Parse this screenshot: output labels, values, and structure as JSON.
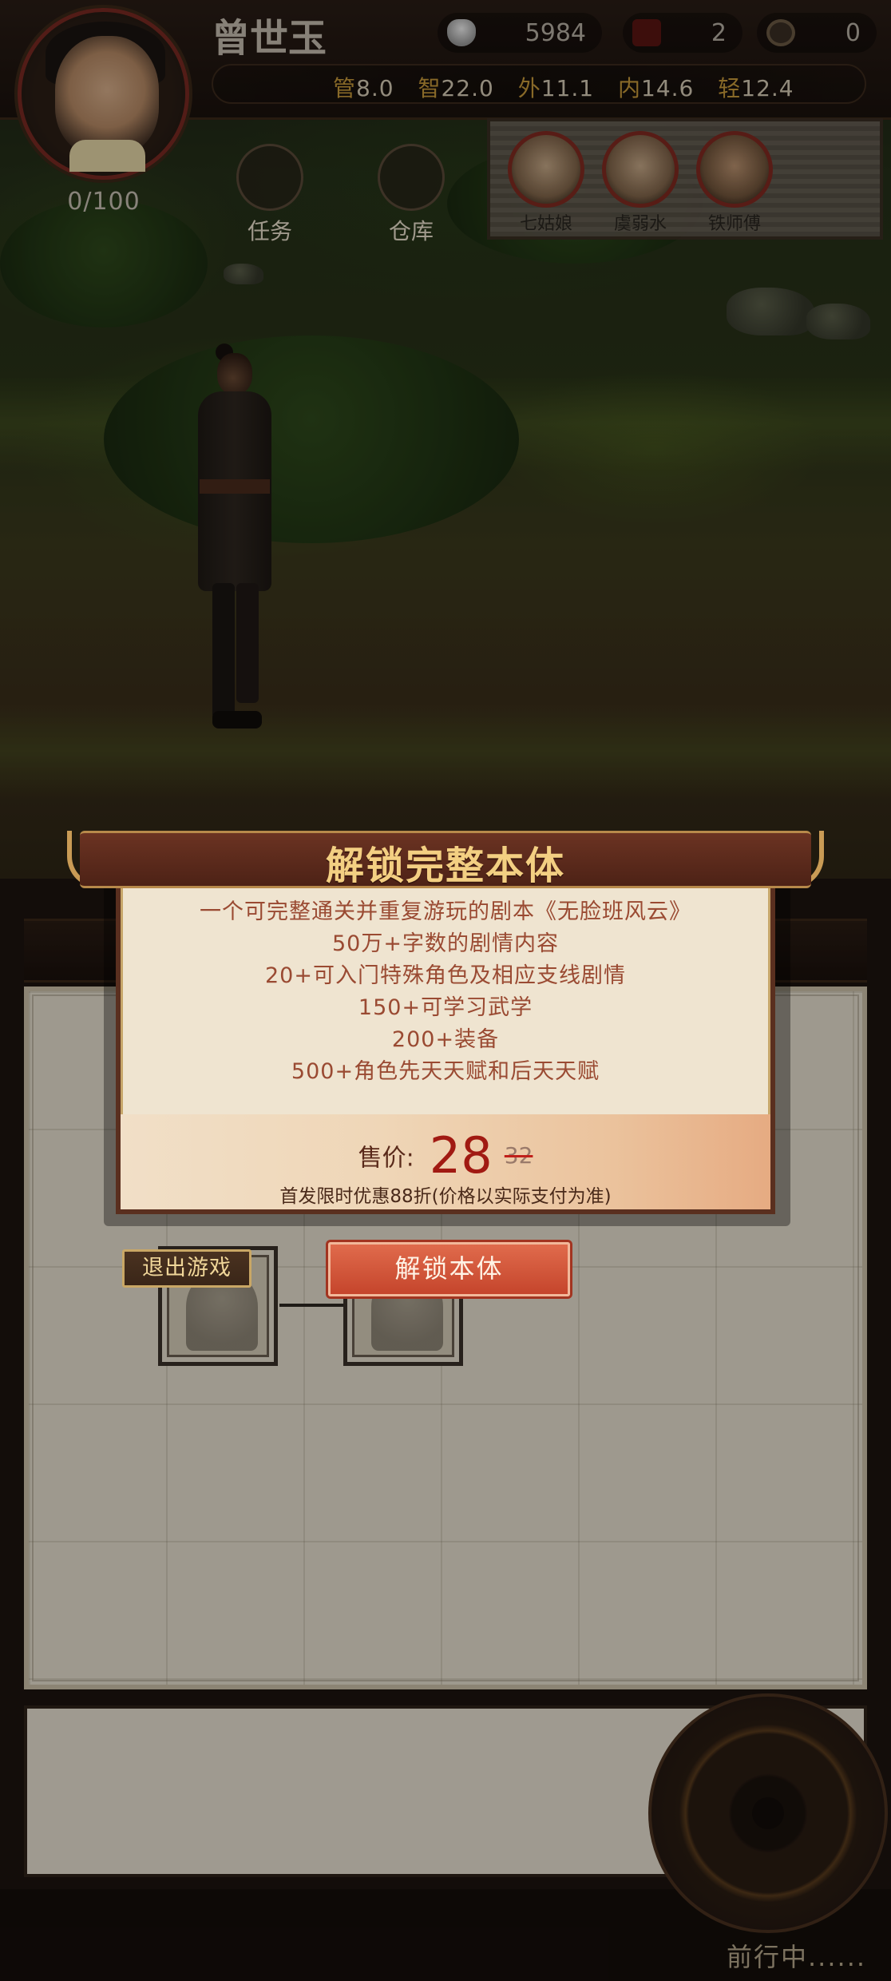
{
  "player": {
    "name": "曾世玉",
    "hp": "0/100"
  },
  "resources": [
    {
      "icon": "silver-ingot-icon",
      "value": "5984"
    },
    {
      "icon": "ticket-icon",
      "value": "2"
    },
    {
      "icon": "coin-icon",
      "value": "0"
    }
  ],
  "stats": [
    {
      "key": "管",
      "value": "8.0"
    },
    {
      "key": "智",
      "value": "22.0"
    },
    {
      "key": "外",
      "value": "11.1"
    },
    {
      "key": "内",
      "value": "14.6"
    },
    {
      "key": "轻",
      "value": "12.4"
    }
  ],
  "hud_buttons": {
    "task": "任务",
    "warehouse": "仓库"
  },
  "party": [
    {
      "name": "七姑娘"
    },
    {
      "name": "虞弱水"
    },
    {
      "name": "铁师傅"
    }
  ],
  "modal": {
    "title": "解锁完整本体",
    "features": [
      "一个可完整通关并重复游玩的剧本《无脸班风云》",
      "50万+字数的剧情内容",
      "20+可入门特殊角色及相应支线剧情",
      "150+可学习武学",
      "200+装备",
      "500+角色先天天赋和后天天赋"
    ],
    "price_label": "售价:",
    "price_now": "28",
    "price_old": "32",
    "price_note": "首发限时优惠88折(价格以实际支付为准)",
    "exit_button": "退出游戏",
    "unlock_button": "解锁本体"
  },
  "status": {
    "moving": "前行中......"
  },
  "colors": {
    "accent_gold": "#f3cf82",
    "price_red": "#a11a12",
    "unlock_button": "#d85a3c",
    "modal_header": "#5a2a1b"
  }
}
